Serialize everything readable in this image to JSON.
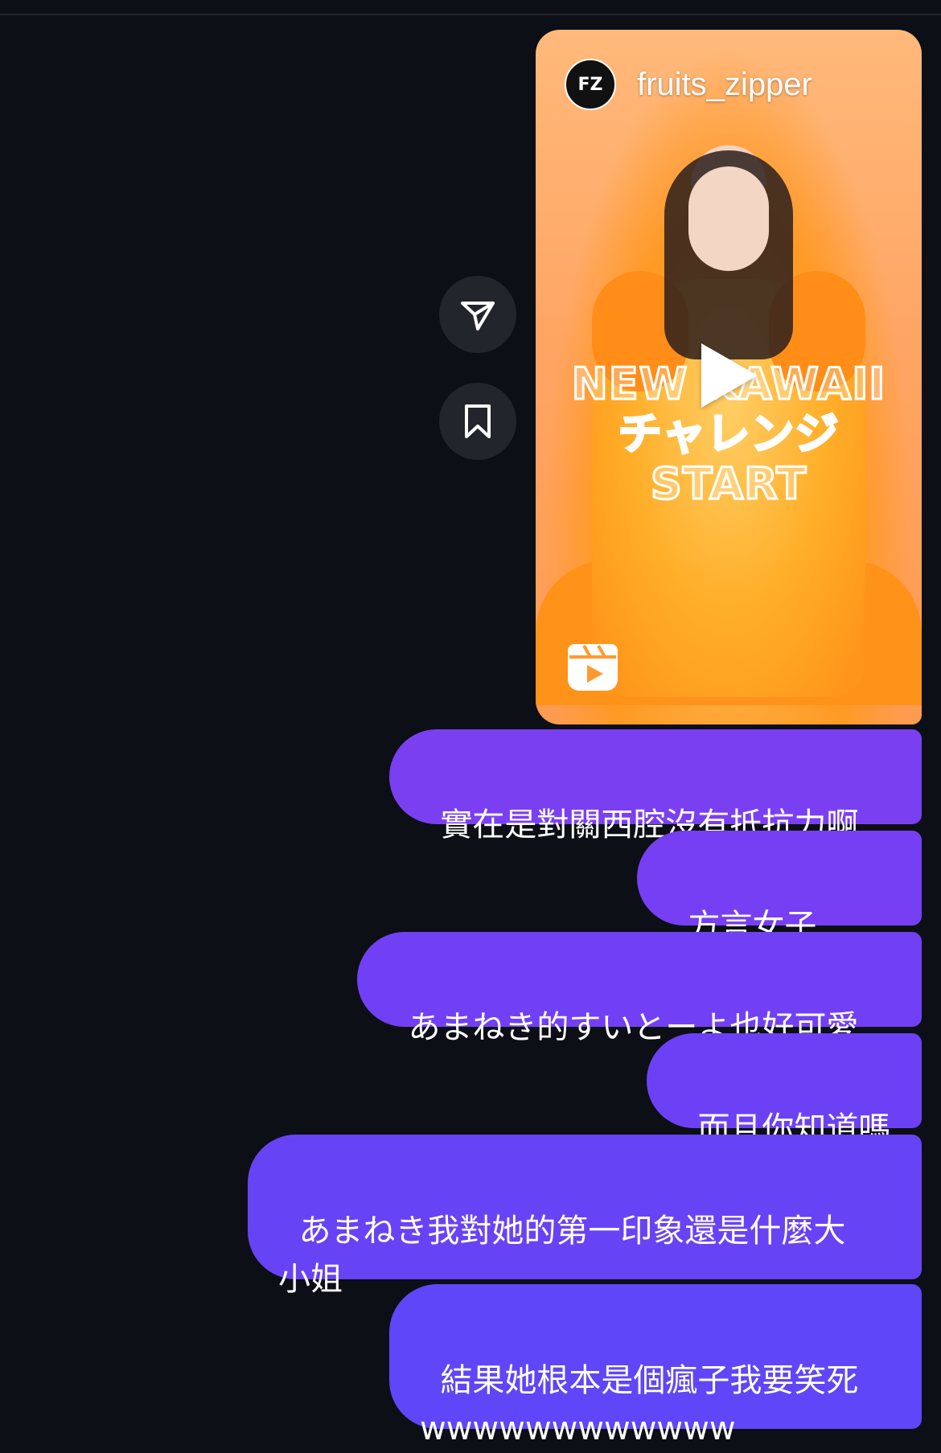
{
  "reel": {
    "account_name": "fruits_zipper",
    "account_logo_text": "FZ",
    "overlay_lines": [
      "NEW KAWAII",
      "チャレンジ",
      "START"
    ],
    "icons": {
      "play": "play-icon",
      "reels": "reels-icon",
      "share": "share-icon",
      "save": "bookmark-icon"
    }
  },
  "messages": [
    {
      "text": "實在是對關西腔沒有抵抗力啊",
      "color": "#7b3ff2"
    },
    {
      "text": "方言女子……",
      "color": "#773ff3"
    },
    {
      "text": "あまねき的すいとーよ也好可愛",
      "color": "#7240f4"
    },
    {
      "text": "而且你知道嗎",
      "color": "#6c41f5"
    },
    {
      "text": "あまねき我對她的第一印象還是什麼大\n小姐",
      "color": "#6743f6"
    },
    {
      "text": "結果她根本是個瘋子我要笑死\nwwwwwwwwwwww",
      "color": "#5f46f8"
    }
  ]
}
